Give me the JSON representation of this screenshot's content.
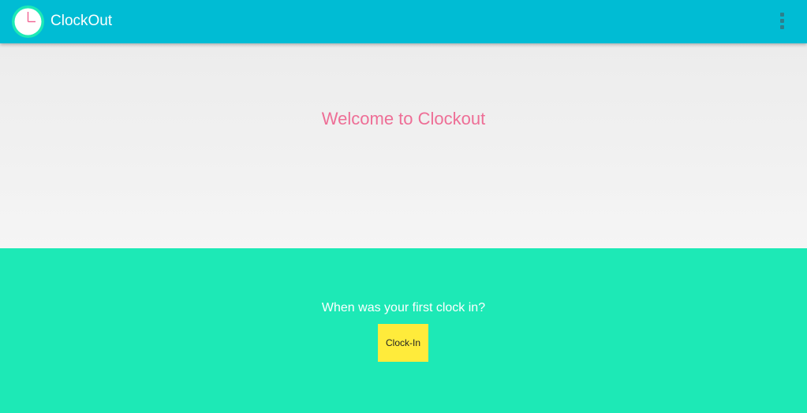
{
  "app_bar": {
    "title": "ClockOut",
    "logo_icon": "clock-icon",
    "menu_icon": "more-vert-icon",
    "color": "#00BCD4"
  },
  "welcome": {
    "heading": "Welcome to Clockout",
    "heading_color": "#EE6E96"
  },
  "clock_in": {
    "question": "When was your first clock in?",
    "button_label": "Clock-In",
    "section_color": "#1DE9B6",
    "button_color": "#FFEB3B"
  }
}
